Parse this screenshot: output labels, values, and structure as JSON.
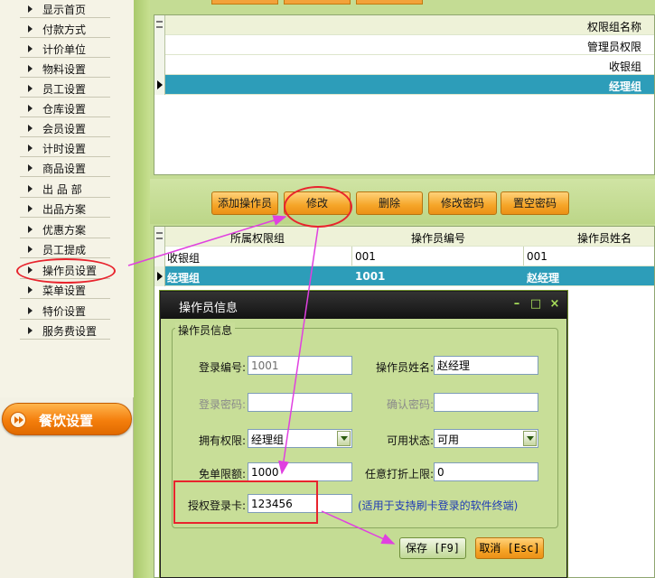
{
  "sidebar": {
    "items": [
      {
        "label": "显示首页"
      },
      {
        "label": "付款方式"
      },
      {
        "label": "计价单位"
      },
      {
        "label": "物料设置"
      },
      {
        "label": "员工设置"
      },
      {
        "label": "仓库设置"
      },
      {
        "label": "会员设置"
      },
      {
        "label": "计时设置"
      },
      {
        "label": "商品设置"
      },
      {
        "label": "出 品 部"
      },
      {
        "label": "出品方案"
      },
      {
        "label": "优惠方案"
      },
      {
        "label": "员工提成"
      },
      {
        "label": "操作员设置"
      },
      {
        "label": "菜单设置"
      },
      {
        "label": "特价设置"
      },
      {
        "label": "服务费设置"
      }
    ],
    "section_button": "餐饮设置"
  },
  "role_table": {
    "header": "权限组名称",
    "rows": [
      "管理员权限",
      "收银组",
      "经理组"
    ]
  },
  "toolbar": {
    "add_operator": "添加操作员",
    "edit": "修改",
    "delete": "删除",
    "change_password": "修改密码",
    "reset_password": "置空密码"
  },
  "operator_table": {
    "headers": [
      "所属权限组",
      "操作员编号",
      "操作员姓名"
    ],
    "rows": [
      [
        "收银组",
        "001",
        "001"
      ],
      [
        "经理组",
        "1001",
        "赵经理"
      ]
    ]
  },
  "dialog": {
    "title": "操作员信息",
    "window_controls": {
      "minimize": "–",
      "maximize": "□",
      "close": "×"
    },
    "group_title": "操作员信息",
    "fields": {
      "login_no": {
        "label": "登录编号:",
        "value": "1001"
      },
      "operator_name": {
        "label": "操作员姓名:",
        "value": "赵经理"
      },
      "login_password": {
        "label": "登录密码:",
        "value": ""
      },
      "confirm_password": {
        "label": "确认密码:",
        "value": ""
      },
      "permission": {
        "label": "拥有权限:",
        "value": "经理组"
      },
      "status": {
        "label": "可用状态:",
        "value": "可用"
      },
      "free_limit": {
        "label": "免单限额:",
        "value": "1000"
      },
      "discount_limit": {
        "label": "任意打折上限:",
        "value": "0"
      },
      "auth_card": {
        "label": "授权登录卡:",
        "value": "123456"
      }
    },
    "hint": "(适用于支持刷卡登录的软件终端)",
    "save_button": "保存 [F9]",
    "cancel_button": "取消 [Esc]"
  },
  "colors": {
    "selection": "#2d9db9",
    "accent_orange": "#f5a528",
    "annotation": "#e8242d",
    "arrow": "#e040e0"
  }
}
